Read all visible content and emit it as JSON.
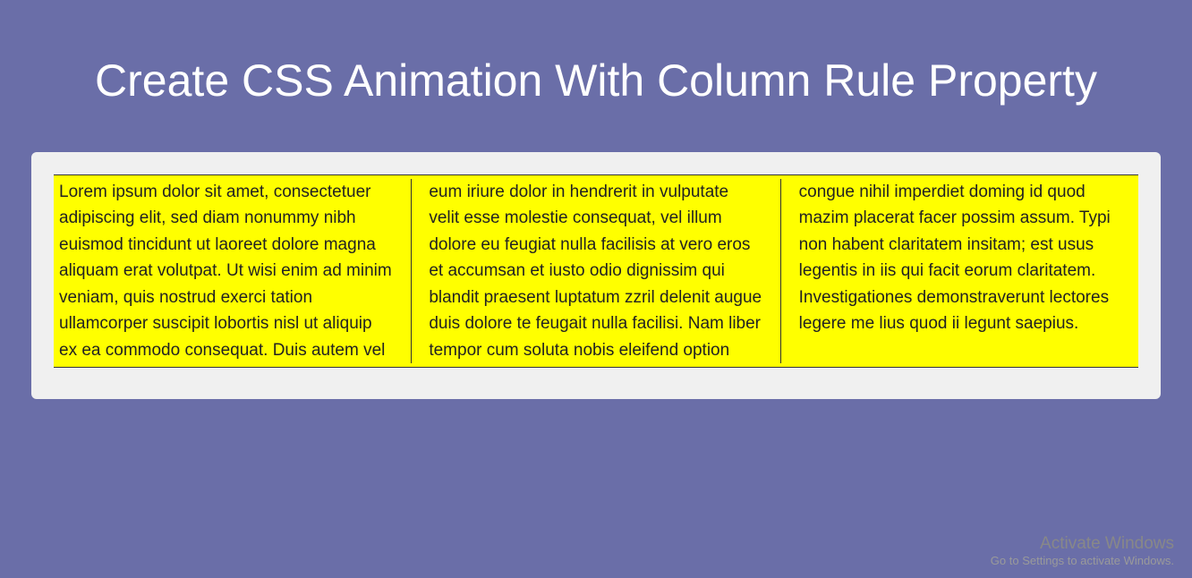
{
  "header": {
    "title": "Create CSS Animation With Column Rule Property"
  },
  "content": {
    "body_text": "Lorem ipsum dolor sit amet, consectetuer adipiscing elit, sed diam nonummy nibh euismod tincidunt ut laoreet dolore magna aliquam erat volutpat. Ut wisi enim ad minim veniam, quis nostrud exerci tation ullamcorper suscipit lobortis nisl ut aliquip ex ea commodo consequat. Duis autem vel eum iriure dolor in hendrerit in vulputate velit esse molestie consequat, vel illum dolore eu feugiat nulla facilisis at vero eros et accumsan et iusto odio dignissim qui blandit praesent luptatum zzril delenit augue duis dolore te feugait nulla facilisi. Nam liber tempor cum soluta nobis eleifend option congue nihil imperdiet doming id quod mazim placerat facer possim assum. Typi non habent claritatem insitam; est usus legentis in iis qui facit eorum claritatem. Investigationes demonstraverunt lectores legere me lius quod ii legunt saepius."
  },
  "watermark": {
    "title": "Activate Windows",
    "subtitle": "Go to Settings to activate Windows."
  },
  "colors": {
    "background": "#6a6ea8",
    "card": "#f0f0f0",
    "highlight": "#ffff00",
    "title_text": "#ffffff"
  }
}
